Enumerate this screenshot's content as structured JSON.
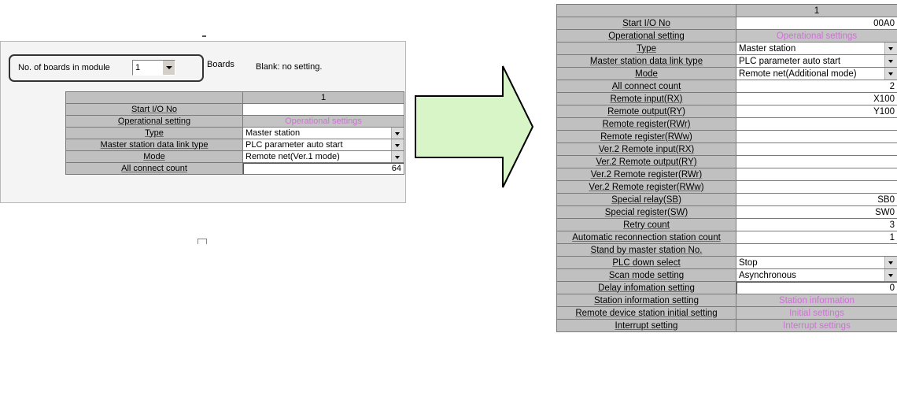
{
  "left": {
    "boards_label": "No. of boards in module",
    "boards_value": "1",
    "boards_unit": "Boards",
    "blank_note": "Blank: no setting.",
    "column_header": "1",
    "rows": [
      {
        "label": "Start I/O No",
        "value": ""
      },
      {
        "label": "Operational setting",
        "value": "Operational settings"
      },
      {
        "label": "Type",
        "value": "Master station"
      },
      {
        "label": "Master station data link type",
        "value": "PLC parameter auto start"
      },
      {
        "label": "Mode",
        "value": "Remote net(Ver.1 mode)"
      },
      {
        "label": "All connect count",
        "value": "64"
      }
    ]
  },
  "right": {
    "column_header": "1",
    "rows": [
      {
        "label": "Start I/O No",
        "value": "00A0"
      },
      {
        "label": "Operational setting",
        "value": "Operational settings"
      },
      {
        "label": "Type",
        "value": "Master station"
      },
      {
        "label": "Master station data link type",
        "value": "PLC parameter auto start"
      },
      {
        "label": "Mode",
        "value": "Remote net(Additional mode)"
      },
      {
        "label": "All connect count",
        "value": "2"
      },
      {
        "label": "Remote input(RX)",
        "value": "X100"
      },
      {
        "label": "Remote output(RY)",
        "value": "Y100"
      },
      {
        "label": "Remote register(RWr)",
        "value": ""
      },
      {
        "label": "Remote register(RWw)",
        "value": ""
      },
      {
        "label": "Ver.2 Remote input(RX)",
        "value": ""
      },
      {
        "label": "Ver.2 Remote output(RY)",
        "value": ""
      },
      {
        "label": "Ver.2 Remote register(RWr)",
        "value": ""
      },
      {
        "label": "Ver.2 Remote register(RWw)",
        "value": ""
      },
      {
        "label": "Special relay(SB)",
        "value": "SB0"
      },
      {
        "label": "Special register(SW)",
        "value": "SW0"
      },
      {
        "label": "Retry count",
        "value": "3"
      },
      {
        "label": "Automatic reconnection station count",
        "value": "1"
      },
      {
        "label": "Stand by master station No.",
        "value": ""
      },
      {
        "label": "PLC down select",
        "value": "Stop"
      },
      {
        "label": "Scan mode setting",
        "value": "Asynchronous"
      },
      {
        "label": "Delay infomation setting",
        "value": "0"
      },
      {
        "label": "Station information setting",
        "value": "Station information"
      },
      {
        "label": "Remote device station initial setting",
        "value": "Initial settings"
      },
      {
        "label": "Interrupt setting",
        "value": "Interrupt settings"
      }
    ]
  },
  "colors": {
    "label_bg": "#c0c0c0",
    "link_text": "#d070d8",
    "arrow_fill": "#d8f5c8"
  }
}
